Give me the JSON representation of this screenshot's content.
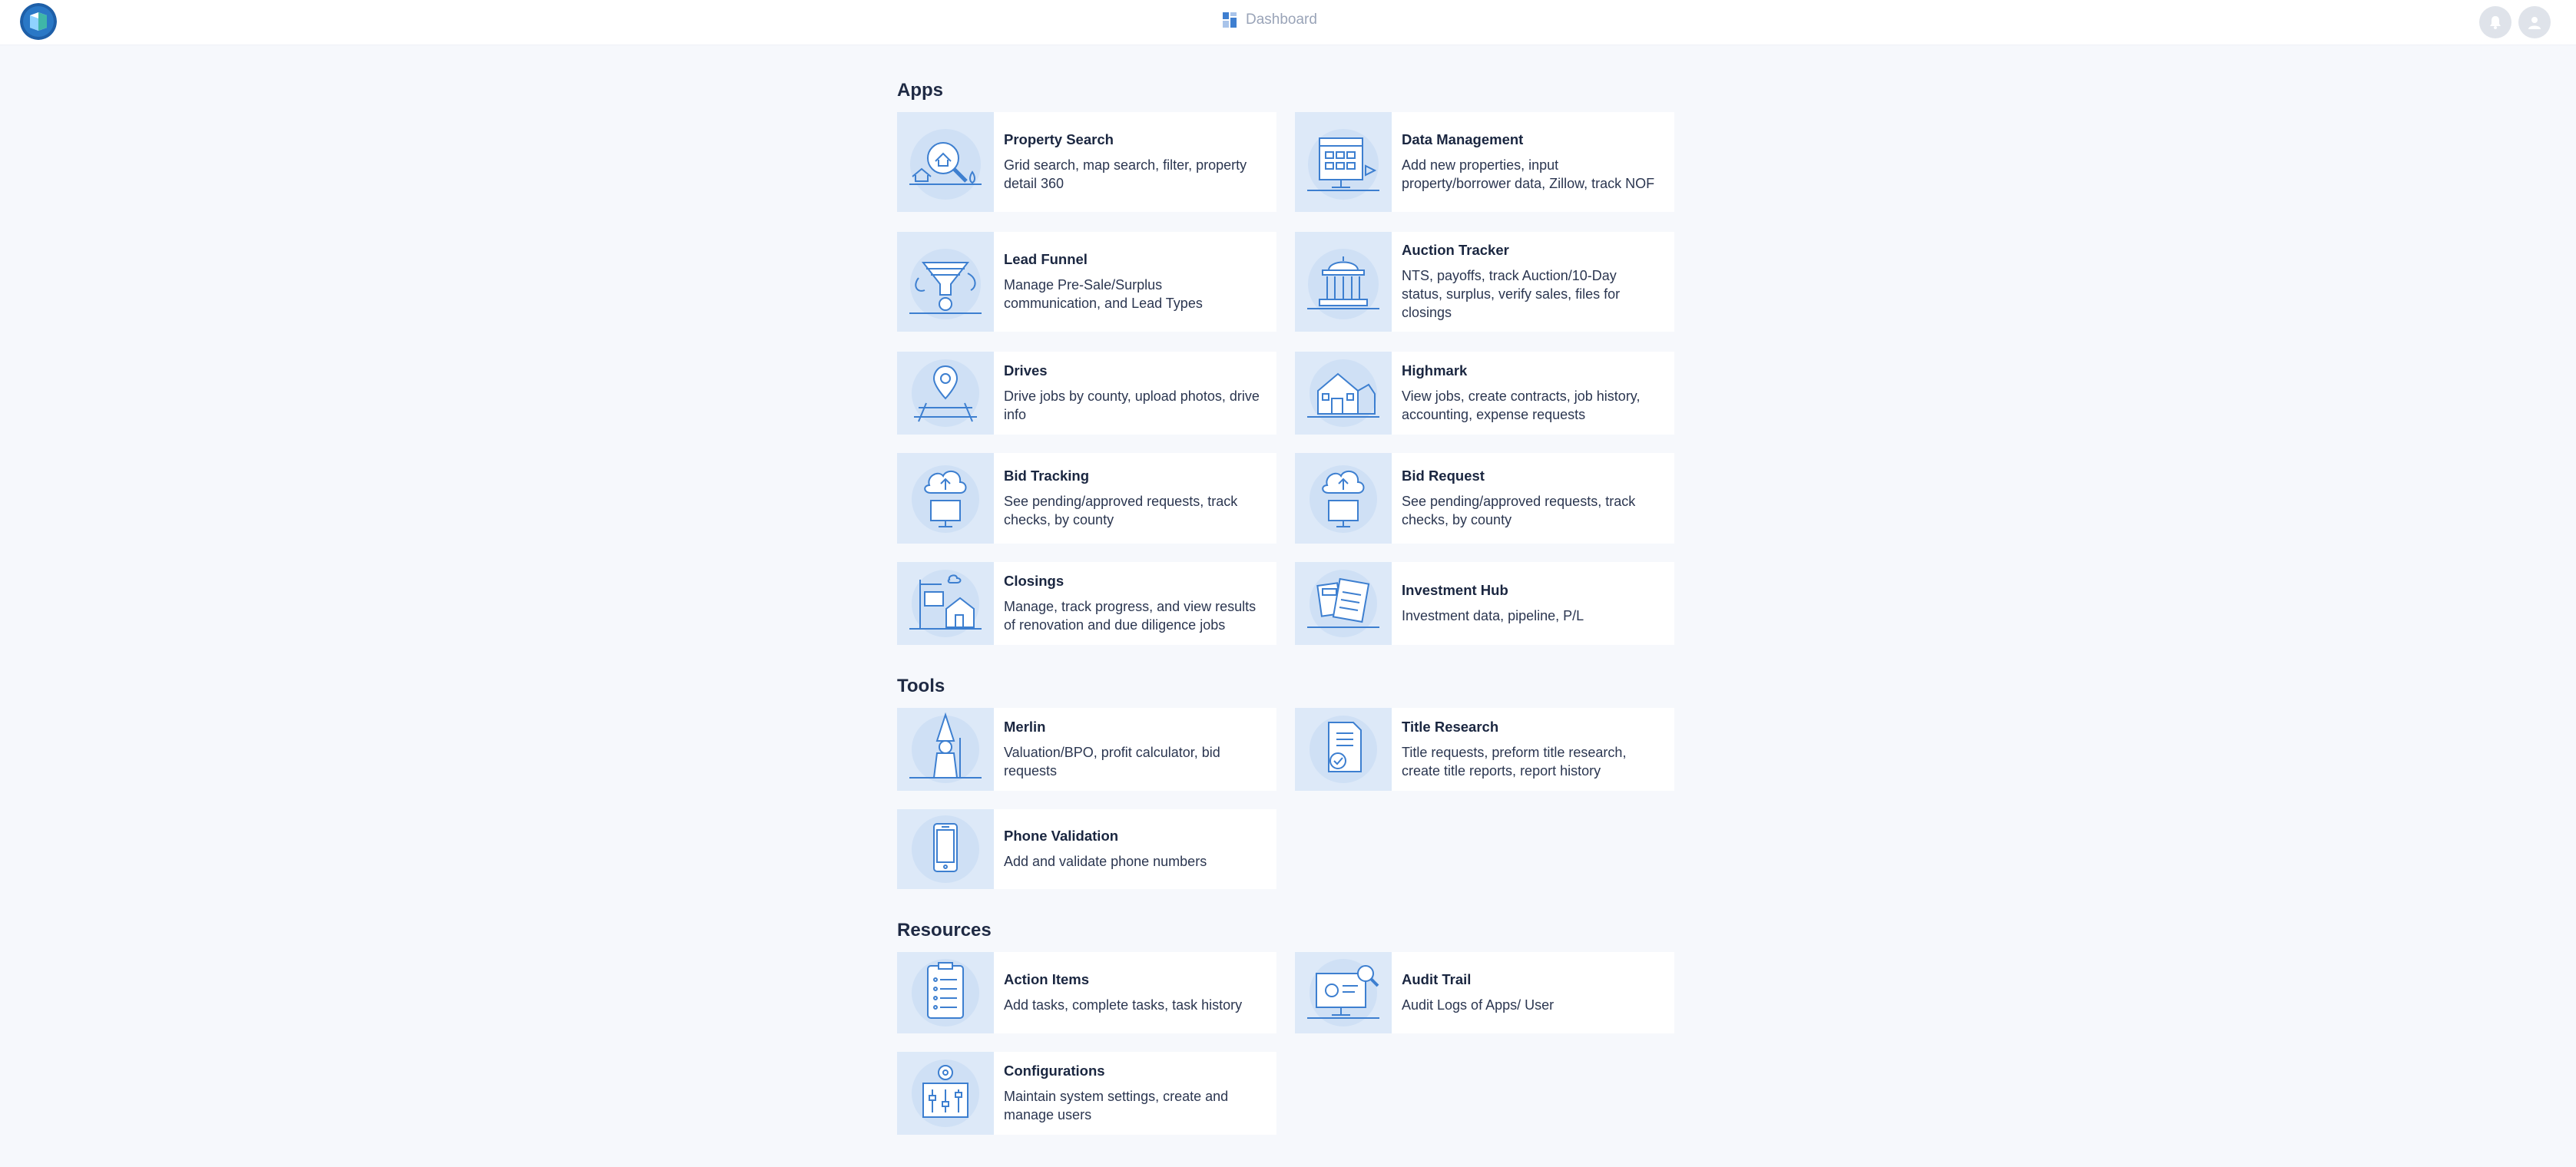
{
  "header": {
    "breadcrumb_label": "Dashboard",
    "brand_color": "#1e5fa8"
  },
  "sections": {
    "apps_title": "Apps",
    "tools_title": "Tools",
    "resources_title": "Resources"
  },
  "apps": [
    {
      "title": "Property Search",
      "desc": "Grid search, map search, filter, property detail 360",
      "icon": "property-search-illustration"
    },
    {
      "title": "Data Management",
      "desc": "Add new properties, input property/borrower data, Zillow, track NOF",
      "icon": "data-management-illustration"
    },
    {
      "title": "Lead Funnel",
      "desc": "Manage Pre-Sale/Surplus communication, and Lead Types",
      "icon": "lead-funnel-illustration"
    },
    {
      "title": "Auction Tracker",
      "desc": "NTS, payoffs, track Auction/10-Day status, surplus, verify sales, files for closings",
      "icon": "auction-tracker-illustration"
    },
    {
      "title": "Drives",
      "desc": "Drive jobs by county, upload photos, drive info",
      "icon": "drives-illustration"
    },
    {
      "title": "Highmark",
      "desc": "View jobs, create contracts, job history, accounting, expense requests",
      "icon": "highmark-illustration"
    },
    {
      "title": "Bid Tracking",
      "desc": "See pending/approved requests, track checks, by county",
      "icon": "bid-tracking-illustration"
    },
    {
      "title": "Bid Request",
      "desc": "See pending/approved requests, track checks, by county",
      "icon": "bid-request-illustration"
    },
    {
      "title": "Closings",
      "desc": "Manage, track progress, and view results of renovation and due diligence jobs",
      "icon": "closings-illustration"
    },
    {
      "title": "Investment Hub",
      "desc": "Investment data, pipeline, P/L",
      "icon": "investment-hub-illustration"
    }
  ],
  "tools": [
    {
      "title": "Merlin",
      "desc": "Valuation/BPO, profit calculator, bid requests",
      "icon": "merlin-illustration"
    },
    {
      "title": "Title Research",
      "desc": "Title requests, preform title research, create title reports, report history",
      "icon": "title-research-illustration"
    },
    {
      "title": "Phone Validation",
      "desc": "Add and validate phone numbers",
      "icon": "phone-validation-illustration"
    }
  ],
  "resources": [
    {
      "title": "Action Items",
      "desc": "Add tasks, complete tasks, task history",
      "icon": "action-items-illustration"
    },
    {
      "title": "Audit Trail",
      "desc": "Audit Logs of Apps/ User",
      "icon": "audit-trail-illustration"
    },
    {
      "title": "Configurations",
      "desc": "Maintain system settings, create and manage users",
      "icon": "configurations-illustration"
    }
  ]
}
